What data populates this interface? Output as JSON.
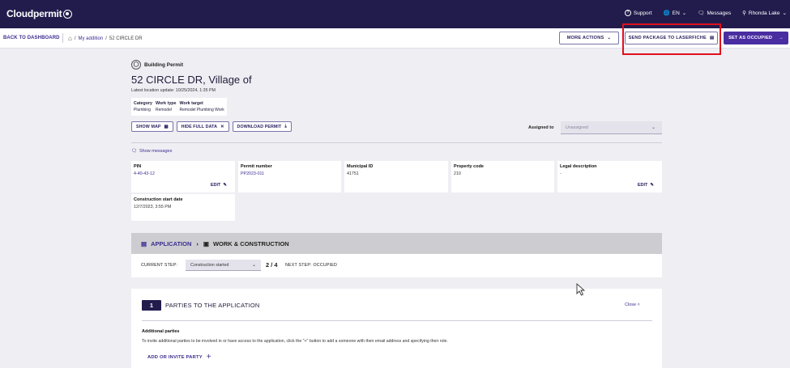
{
  "topbar": {
    "logo": "Cloudpermit",
    "support": "Support",
    "language": "EN",
    "messages": "Messages",
    "user": "Rhonda Lake"
  },
  "subbar": {
    "back": "BACK TO DASHBOARD",
    "crumb_sep": "/",
    "crumb_my": "My addition",
    "crumb_current": "52 CIRCLE DR",
    "more_actions": "MORE ACTIONS",
    "laserfiche": "SEND PACKAGE TO LASERFICHE",
    "occupied": "SET AS OCCUPIED"
  },
  "permit": {
    "type": "Building Permit",
    "address": "52 CIRCLE DR, Village of",
    "latest_update": "Latest location update: 10/25/2024, 1:35 PM",
    "tags": [
      {
        "label": "Category",
        "value": "Plumbing"
      },
      {
        "label": "Work type",
        "value": "Remodel"
      },
      {
        "label": "Work target",
        "value": "Remodel Plumbing Work"
      }
    ],
    "show_map": "SHOW MAP",
    "hide_full": "HIDE FULL DATA",
    "download": "DOWNLOAD PERMIT",
    "assigned_label": "Assigned to",
    "assigned_value": "Unassigned",
    "show_messages": "Show messages"
  },
  "cards": {
    "pin": {
      "label": "PIN",
      "value": "4-40-43-12",
      "edit": "EDIT"
    },
    "permit_number": {
      "label": "Permit number",
      "value": "PP2023-011"
    },
    "municipal_id": {
      "label": "Municipal ID",
      "value": "41751"
    },
    "property_code": {
      "label": "Property code",
      "value": "210"
    },
    "legal": {
      "label": "Legal description",
      "value": "-",
      "edit": "EDIT"
    },
    "construction": {
      "label": "Construction start date",
      "value": "12/7/2023, 3:55 PM"
    }
  },
  "steps": {
    "application": "APPLICATION",
    "work": "WORK & CONSTRUCTION",
    "current_label": "CURRENT STEP:",
    "current_value": "Construction started",
    "progress": "2 / 4",
    "next": "NEXT STEP: OCCUPIED"
  },
  "parties": {
    "number": "1",
    "title": "PARTIES TO THE APPLICATION",
    "close": "Close",
    "additional": "Additional parties",
    "description": "To invite additional parties to be involved in or have access to the application, click the \"+\" button to add a someone with their email address and specifying their role.",
    "invite": "ADD OR INVITE PARTY"
  },
  "icons": {
    "support": "help-circle-icon",
    "language": "globe-icon",
    "messages": "chat-icon",
    "user": "user-icon"
  },
  "colors": {
    "topbar": "#221c4d",
    "accent": "#4a2ea1",
    "highlight": "#e0101c"
  }
}
